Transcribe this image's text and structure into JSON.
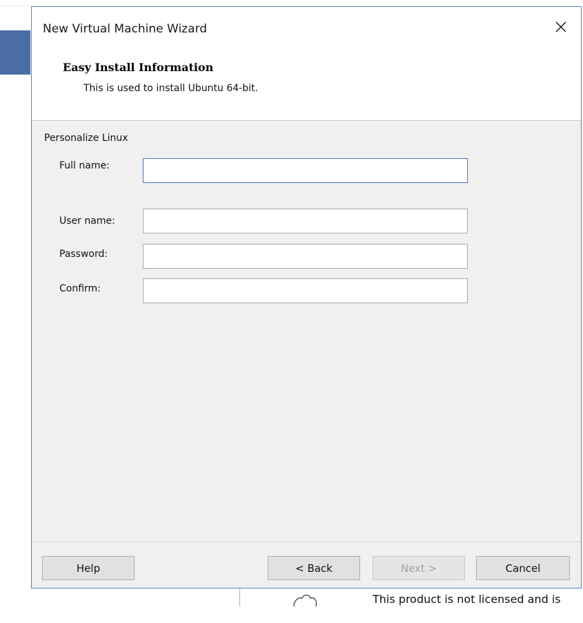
{
  "window": {
    "title": "New Virtual Machine Wizard",
    "close_icon": "close-icon"
  },
  "header": {
    "title": "Easy Install Information",
    "subtitle": "This is used to install Ubuntu 64-bit."
  },
  "section": {
    "label": "Personalize Linux"
  },
  "fields": {
    "full_name": {
      "label": "Full name:",
      "value": ""
    },
    "user_name": {
      "label": "User name:",
      "value": ""
    },
    "password": {
      "label": "Password:",
      "value": ""
    },
    "confirm": {
      "label": "Confirm:",
      "value": ""
    }
  },
  "buttons": {
    "help": "Help",
    "back": "< Back",
    "next": "Next >",
    "cancel": "Cancel"
  },
  "background": {
    "notice": "This product is not licensed and is"
  },
  "colors": {
    "dialog_border": "#4a86c8",
    "focus_border": "#3c78c8",
    "dialog_bg": "#f0f0f0"
  }
}
